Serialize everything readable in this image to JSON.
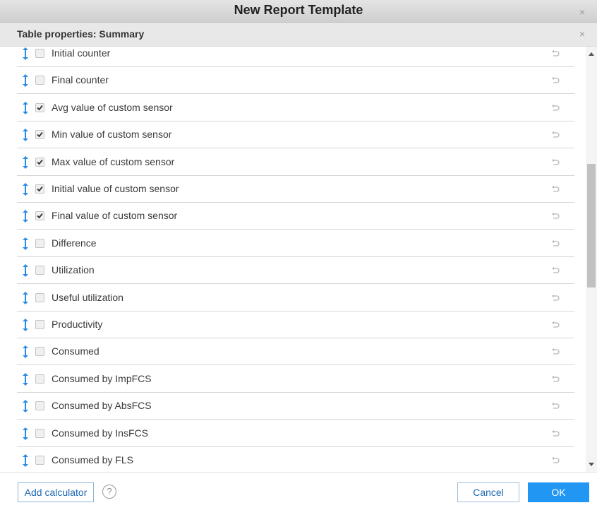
{
  "window": {
    "title": "New Report Template"
  },
  "panel": {
    "title": "Table properties: Summary"
  },
  "rows": [
    {
      "label": "Initial counter",
      "checked": false
    },
    {
      "label": "Final counter",
      "checked": false
    },
    {
      "label": "Avg value of custom sensor",
      "checked": true
    },
    {
      "label": "Min value of custom sensor",
      "checked": true
    },
    {
      "label": "Max value of custom sensor",
      "checked": true
    },
    {
      "label": "Initial value of custom sensor",
      "checked": true
    },
    {
      "label": "Final value of custom sensor",
      "checked": true
    },
    {
      "label": "Difference",
      "checked": false
    },
    {
      "label": "Utilization",
      "checked": false
    },
    {
      "label": "Useful utilization",
      "checked": false
    },
    {
      "label": "Productivity",
      "checked": false
    },
    {
      "label": "Consumed",
      "checked": false
    },
    {
      "label": "Consumed by ImpFCS",
      "checked": false
    },
    {
      "label": "Consumed by AbsFCS",
      "checked": false
    },
    {
      "label": "Consumed by InsFCS",
      "checked": false
    },
    {
      "label": "Consumed by FLS",
      "checked": false
    }
  ],
  "footer": {
    "add_calculator": "Add calculator",
    "help": "?",
    "cancel": "Cancel",
    "ok": "OK"
  },
  "icons": {
    "window_close": "close-icon",
    "panel_close": "close-icon",
    "drag": "vertical-drag-icon",
    "reset": "reset-undo-icon",
    "help": "help-icon"
  },
  "colors": {
    "accent": "#2196f3",
    "drag_icon": "#2b8be6",
    "frame": "#1f7ac6"
  }
}
